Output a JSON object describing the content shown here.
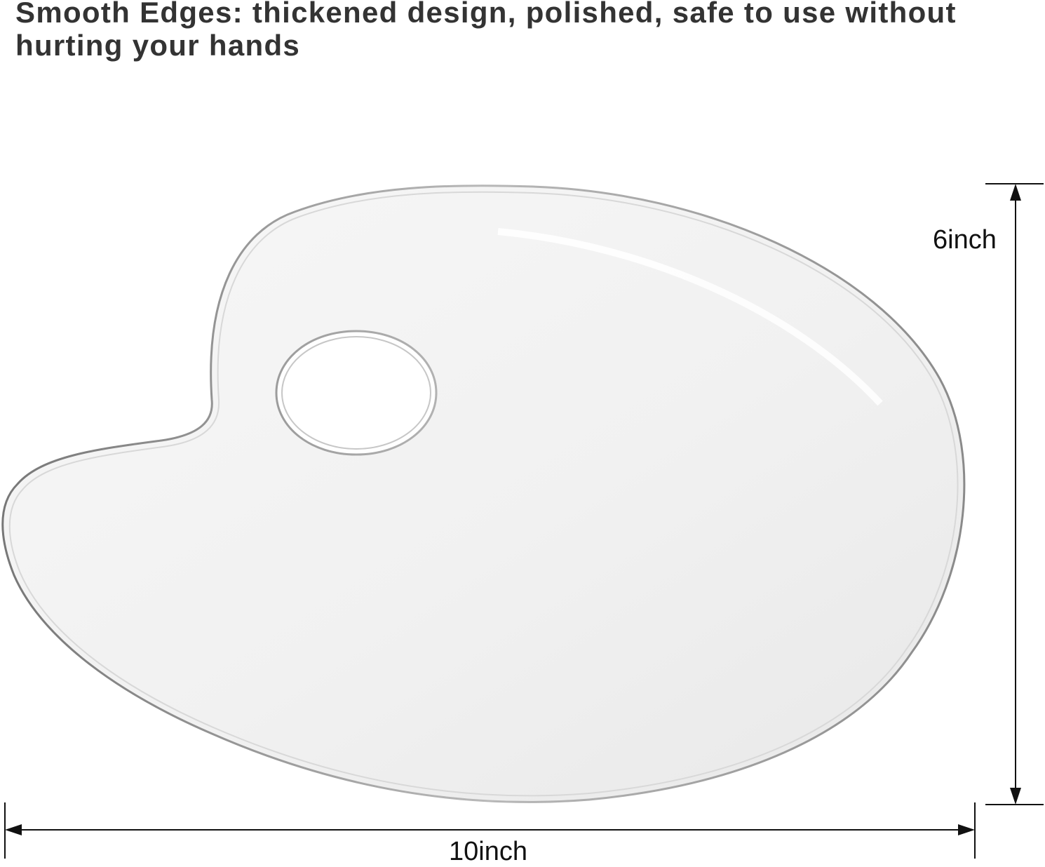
{
  "headline": "Smooth Edges: thickened design, polished, safe to use without hurting your hands",
  "dimensions": {
    "height_label": "6inch",
    "width_label": "10inch"
  },
  "colors": {
    "text": "#333333",
    "dimension_line": "#111111",
    "palette_edge": "#8f8f8f",
    "palette_fill": "#f2f2f2"
  },
  "icons": {
    "palette": "paint-palette-icon"
  }
}
